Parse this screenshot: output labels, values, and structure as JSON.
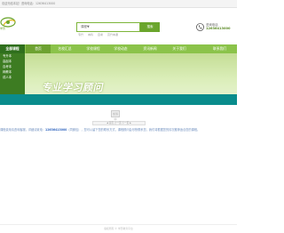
{
  "topbar": {
    "greeting": "欢迎光临本站！",
    "phone_label": "咨询电话：",
    "phone": "12636413000"
  },
  "header": {
    "logo_text": "学历",
    "search": {
      "select_label": "课程▼",
      "button_label": "搜索",
      "hotwords": [
        "专升",
        "本科",
        "自考",
        "高升本课"
      ]
    },
    "contact_label": "咨询电话",
    "contact_number": "12636413000"
  },
  "nav": {
    "all_categories": "全部课程",
    "items": [
      {
        "label": "首页",
        "active": true
      },
      {
        "label": "名校汇总",
        "active": false
      },
      {
        "label": "学校课程",
        "active": false
      },
      {
        "label": "学校动态",
        "active": false
      },
      {
        "label": "资讯新闻",
        "active": false
      },
      {
        "label": "关于我们",
        "active": false
      },
      {
        "label": "联系我们",
        "active": false
      }
    ]
  },
  "banner": {
    "side_items": [
      "专升本",
      "高起本",
      "自考本",
      "网教本",
      "成人本"
    ],
    "title": "专业学习顾问"
  },
  "content": {
    "loading": "加载中",
    "pager": "◄ 首页 上一页 下一页 ►",
    "notice_prefix": "课程费用请咨询客服，详细请致电：",
    "notice_phone": "12636413000",
    "notice_suffix": "（同微信），您可以留下您的联系方式，课程顾问会尽快联系您，我们将根据您的情况推荐适合您的课程。"
  },
  "footer": {
    "text": "版权所有 © 学历教育平台"
  },
  "colors": {
    "nav_green": "#8bc34a",
    "dark_green": "#2f6f1d",
    "teal": "#0a8c8c",
    "link_blue": "#3468c0"
  }
}
